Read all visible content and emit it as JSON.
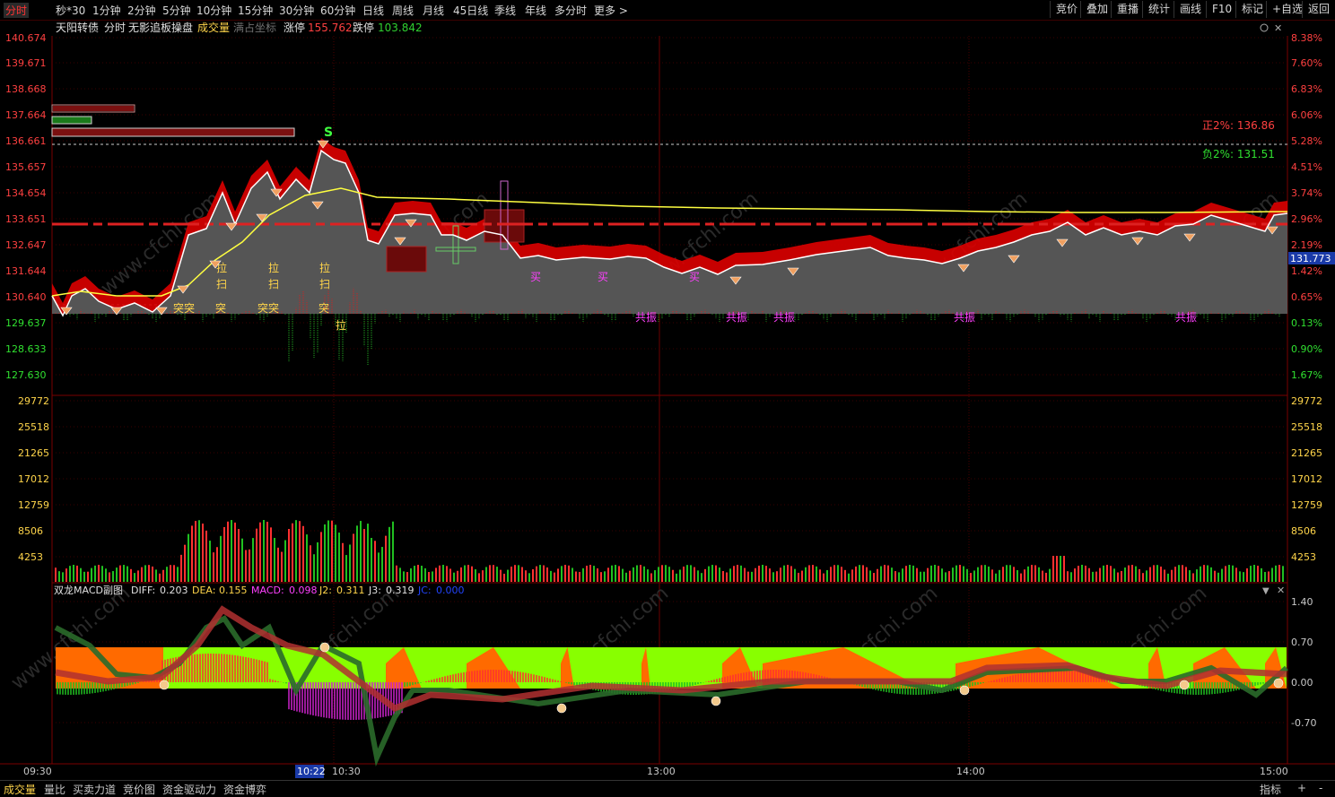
{
  "toolbar": {
    "periods": [
      "分时",
      "秒*30",
      "1分钟",
      "2分钟",
      "5分钟",
      "10分钟",
      "15分钟",
      "30分钟",
      "60分钟",
      "日线",
      "周线",
      "月线",
      "45日线",
      "季线",
      "年线",
      "多分时",
      "更多 >"
    ],
    "active_period": "分时",
    "right_buttons": [
      "竞价",
      "叠加",
      "重播",
      "统计",
      "画线",
      "F10",
      "标记",
      "+自选",
      "返回"
    ]
  },
  "header": {
    "name": "天阳转债",
    "mode": "分时",
    "indicator": "无影追板操盘",
    "volume_label": "成交量",
    "coord_label": "满占坐标",
    "limit_up_label": "涨停",
    "limit_up_value": "155.762",
    "limit_down_label": "跌停",
    "limit_down_value": "103.842"
  },
  "price_axis": {
    "left": [
      "140.674",
      "139.671",
      "138.668",
      "137.664",
      "136.661",
      "135.657",
      "134.654",
      "133.651",
      "132.647",
      "131.644",
      "130.640",
      "129.637",
      "128.633",
      "127.630"
    ],
    "right": [
      "8.38%",
      "7.60%",
      "6.83%",
      "6.06%",
      "5.28%",
      "4.51%",
      "3.74%",
      "2.96%",
      "2.19%",
      "1.42%",
      "0.65%",
      "0.13%",
      "0.90%",
      "1.67%"
    ],
    "current_price": "131.773"
  },
  "annotations": {
    "pos2": "正2%: 136.86",
    "neg2": "负2%: 131.51",
    "s_mark": "S",
    "la": "拉",
    "sao": "扫",
    "tu": "突",
    "tutu": "突突",
    "mai": "买",
    "gongzhen": "共振"
  },
  "volume_axis": [
    "29772",
    "25518",
    "21265",
    "17012",
    "12759",
    "8506",
    "4253"
  ],
  "macd": {
    "title": "双龙MACD副图",
    "diff_label": "DIFF:",
    "diff": "0.203",
    "dea_label": "DEA:",
    "dea": "0.155",
    "macd_label": "MACD:",
    "macd": "0.098",
    "j2_label": "J2:",
    "j2": "0.311",
    "j3_label": "J3:",
    "j3": "0.319",
    "jc_label": "JC:",
    "jc": "0.000",
    "axis": [
      "1.40",
      "0.70",
      "0.00",
      "-0.70"
    ]
  },
  "time_axis": [
    "09:30",
    "10:30",
    "13:00",
    "14:00",
    "15:00"
  ],
  "cursor_time": "10:22",
  "status_tabs": [
    "成交量",
    "量比",
    "买卖力道",
    "竞价图",
    "资金驱动力",
    "资金博弈"
  ],
  "status_right": [
    "指标",
    "+",
    "-"
  ],
  "watermark": "www.cfchi.com",
  "colors": {
    "up": "#ff3030",
    "down": "#20c020",
    "avg": "#ffff40",
    "price": "#ffffff",
    "fill": "#555555",
    "orange": "#ff6a00",
    "lime": "#88ff00"
  }
}
